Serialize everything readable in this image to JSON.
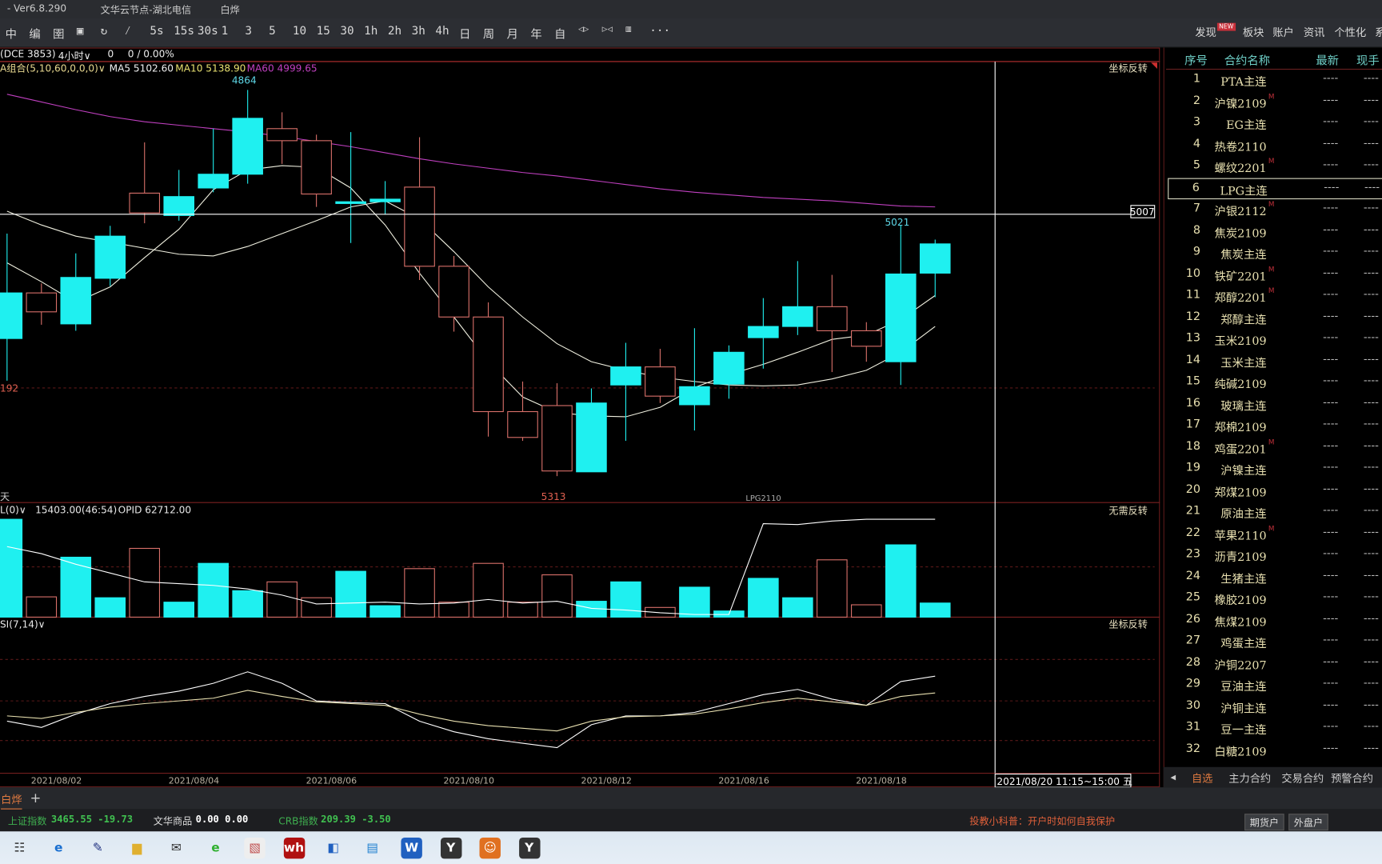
{
  "titlebar": {
    "version": "- Ver6.8.290",
    "server": "文华云节点-湖北电信",
    "account": "白烨"
  },
  "toolbar": {
    "icons": [
      "split-icon",
      "draw-icon",
      "layout-icon",
      "save-icon",
      "refresh-icon",
      "indicator-icon"
    ],
    "periods": [
      "5s",
      "15s",
      "30s",
      "1",
      "3",
      "5",
      "10",
      "15",
      "30",
      "1h",
      "2h",
      "3h",
      "4h",
      "日",
      "周",
      "月",
      "年",
      "自"
    ],
    "tail_icons": [
      "expand-icon",
      "compress-icon",
      "panel-icon"
    ],
    "more": "···",
    "right": [
      "发现",
      "板块",
      "账户",
      "资讯",
      "个性化",
      "系"
    ],
    "new_badge": "NEW"
  },
  "info": {
    "contract": "(DCE 3853)",
    "period": "4小时∨",
    "value": "0",
    "change": "0 / 0.00%"
  },
  "main_panel": {
    "indicator": "A组合(5,10,60,0,0,0)∨",
    "ma5": "MA5 5102.60",
    "ma10": "MA10 5138.90",
    "ma60": "MA60 4999.65",
    "flip": "坐标反转",
    "crosshair_price": "5007",
    "hi_label": "4864",
    "lo_label": "5313",
    "mark_5021": "5021",
    "left_label": "192",
    "contract_tag": "LPG2110",
    "day_label": "天"
  },
  "vol_panel": {
    "header": "L(0)∨",
    "vol": "15403.00(46:54)",
    "opid": "OPID 62712.00",
    "flip": "无需反转"
  },
  "rsi_panel": {
    "header": "SI(7,14)∨",
    "flip": "坐标反转"
  },
  "date_axis": {
    "labels": [
      "2021/08/02",
      "2021/08/04",
      "2021/08/06",
      "2021/08/10",
      "2021/08/12",
      "2021/08/16",
      "2021/08/18"
    ],
    "cursor": "2021/08/20 11:15~15:00 五"
  },
  "colors": {
    "up": "#d9706a",
    "down": "#1ff0f0",
    "ma60": "#c040c0",
    "ma": "#f0f0e0",
    "bg": "#000000"
  },
  "chart_data": [
    {
      "type": "candlestick",
      "axis_inverted": true,
      "ylim": [
        4864,
        5313
      ],
      "candles": [
        {
          "o": 5153,
          "c": 5100,
          "h": 5202,
          "l": 5031
        },
        {
          "o": 5100,
          "c": 5122,
          "h": 5137,
          "l": 5089
        },
        {
          "o": 5136,
          "c": 5082,
          "h": 5144,
          "l": 5054
        },
        {
          "o": 5083,
          "c": 5034,
          "h": 5092,
          "l": 5022
        },
        {
          "o": 4984,
          "c": 5007,
          "h": 5019,
          "l": 4925
        },
        {
          "o": 5010,
          "c": 4988,
          "h": 5016,
          "l": 4957
        },
        {
          "o": 4978,
          "c": 4962,
          "h": 4983,
          "l": 4909
        },
        {
          "o": 4962,
          "c": 4897,
          "h": 4973,
          "l": 4864
        },
        {
          "o": 4909,
          "c": 4923,
          "h": 4950,
          "l": 4890
        },
        {
          "o": 4923,
          "c": 4985,
          "h": 5000,
          "l": 4916
        },
        {
          "o": 4996,
          "c": 4994,
          "h": 5042,
          "l": 4913
        },
        {
          "o": 4994,
          "c": 4991,
          "h": 5009,
          "l": 4970
        },
        {
          "o": 4977,
          "c": 5069,
          "h": 5085,
          "l": 4919
        },
        {
          "o": 5069,
          "c": 5128,
          "h": 5145,
          "l": 5057
        },
        {
          "o": 5128,
          "c": 5238,
          "h": 5267,
          "l": 5111
        },
        {
          "o": 5238,
          "c": 5268,
          "h": 5272,
          "l": 5203
        },
        {
          "o": 5231,
          "c": 5307,
          "h": 5313,
          "l": 5205
        },
        {
          "o": 5308,
          "c": 5228,
          "h": 5308,
          "l": 5211
        },
        {
          "o": 5207,
          "c": 5186,
          "h": 5272,
          "l": 5158
        },
        {
          "o": 5186,
          "c": 5220,
          "h": 5228,
          "l": 5165
        },
        {
          "o": 5230,
          "c": 5209,
          "h": 5260,
          "l": 5141
        },
        {
          "o": 5206,
          "c": 5169,
          "h": 5223,
          "l": 5161
        },
        {
          "o": 5152,
          "c": 5139,
          "h": 5188,
          "l": 5106
        },
        {
          "o": 5139,
          "c": 5116,
          "h": 5149,
          "l": 5063
        },
        {
          "o": 5116,
          "c": 5144,
          "h": 5192,
          "l": 5079
        },
        {
          "o": 5144,
          "c": 5162,
          "h": 5180,
          "l": 5134
        },
        {
          "o": 5180,
          "c": 5078,
          "h": 5207,
          "l": 5021
        },
        {
          "o": 5077,
          "c": 5043,
          "h": 5105,
          "l": 5038
        }
      ],
      "series": [
        {
          "name": "MA5",
          "values": [
            5065,
            5087,
            5111,
            5093,
            5059,
            5026,
            4980,
            4957,
            4952,
            4954,
            4978,
            5021,
            5077,
            5128,
            5180,
            5221,
            5239,
            5243,
            5244,
            5233,
            5210,
            5195,
            5183,
            5169,
            5154,
            5149,
            5131,
            5103
          ]
        },
        {
          "name": "MA10",
          "values": [
            5005,
            5021,
            5034,
            5041,
            5048,
            5055,
            5057,
            5046,
            5031,
            5016,
            5000,
            4993,
            5014,
            5052,
            5093,
            5128,
            5159,
            5180,
            5190,
            5198,
            5203,
            5207,
            5208,
            5207,
            5200,
            5190,
            5169,
            5139
          ]
        },
        {
          "name": "MA60",
          "values": [
            4869,
            4878,
            4887,
            4895,
            4901,
            4905,
            4909,
            4913,
            4918,
            4924,
            4930,
            4937,
            4944,
            4950,
            4955,
            4960,
            4964,
            4969,
            4974,
            4979,
            4983,
            4986,
            4989,
            4991,
            4993,
            4996,
            4999,
            5000
          ]
        }
      ]
    },
    {
      "type": "bar",
      "volume": [
        106900,
        22150,
        65480,
        21190,
        75110,
        16370,
        58740,
        28890,
        38520,
        21190,
        50080,
        12520,
        52970,
        16370,
        58740,
        16370,
        46220,
        17330,
        38520,
        10590,
        32740,
        6740,
        42370,
        21190,
        62600,
        13480,
        78970,
        15403
      ],
      "open_interest": [
        59612,
        58812,
        57612,
        56612,
        55612,
        55412,
        55212,
        54812,
        54112,
        53112,
        53212,
        53312,
        53112,
        53212,
        53612,
        53212,
        53412,
        52612,
        52412,
        52112,
        51912,
        51912,
        62212,
        62112,
        62512,
        62712,
        62712,
        62712
      ]
    },
    {
      "type": "line",
      "axis_inverted": true,
      "gridlines": [
        20,
        50,
        80
      ],
      "series": [
        {
          "values": [
            65.0,
            69.6,
            59.8,
            52.0,
            46.7,
            42.8,
            37.0,
            28.5,
            37.0,
            50,
            51.3,
            52.0,
            65.0,
            72.8,
            78.0,
            81.3,
            84.6,
            67.6,
            61.1,
            61.1,
            58.5,
            52.0,
            45.4,
            41.5,
            48.7,
            53.3,
            35.7,
            31.7
          ]
        },
        {
          "values": [
            61.1,
            63.0,
            58.5,
            54.6,
            52.0,
            50,
            48.0,
            42.2,
            46.7,
            50.7,
            52.0,
            53.3,
            59.8,
            65.0,
            68.3,
            70.2,
            72.2,
            65.0,
            61.7,
            61.1,
            59.8,
            55.9,
            51.3,
            48.0,
            50.7,
            53.3,
            46.7,
            44.1
          ]
        }
      ]
    }
  ],
  "quote_list": {
    "headers": [
      "序号",
      "合约名称",
      "最新",
      "现手"
    ],
    "dash": "----",
    "rows": [
      {
        "n": "1",
        "name": "PTA主连"
      },
      {
        "n": "2",
        "name": "沪镍2109",
        "m": "M"
      },
      {
        "n": "3",
        "name": "EG主连"
      },
      {
        "n": "4",
        "name": "热卷2110"
      },
      {
        "n": "5",
        "name": "螺纹2201",
        "m": "M"
      },
      {
        "n": "6",
        "name": "LPG主连"
      },
      {
        "n": "7",
        "name": "沪银2112",
        "m": "M"
      },
      {
        "n": "8",
        "name": "焦炭2109"
      },
      {
        "n": "9",
        "name": "焦炭主连"
      },
      {
        "n": "10",
        "name": "铁矿2201",
        "m": "M"
      },
      {
        "n": "11",
        "name": "郑醇2201",
        "m": "M"
      },
      {
        "n": "12",
        "name": "郑醇主连"
      },
      {
        "n": "13",
        "name": "玉米2109"
      },
      {
        "n": "14",
        "name": "玉米主连"
      },
      {
        "n": "15",
        "name": "纯碱2109"
      },
      {
        "n": "16",
        "name": "玻璃主连"
      },
      {
        "n": "17",
        "name": "郑棉2109"
      },
      {
        "n": "18",
        "name": "鸡蛋2201",
        "m": "M"
      },
      {
        "n": "19",
        "name": "沪镍主连"
      },
      {
        "n": "20",
        "name": "郑煤2109"
      },
      {
        "n": "21",
        "name": "原油主连"
      },
      {
        "n": "22",
        "name": "苹果2110",
        "m": "M"
      },
      {
        "n": "23",
        "name": "沥青2109"
      },
      {
        "n": "24",
        "name": "生猪主连"
      },
      {
        "n": "25",
        "name": "橡胶2109"
      },
      {
        "n": "26",
        "name": "焦煤2109"
      },
      {
        "n": "27",
        "name": "鸡蛋主连"
      },
      {
        "n": "28",
        "name": "沪铜2207"
      },
      {
        "n": "29",
        "name": "豆油主连"
      },
      {
        "n": "30",
        "name": "沪铜主连"
      },
      {
        "n": "31",
        "name": "豆一主连"
      },
      {
        "n": "32",
        "name": "白糖2109"
      }
    ],
    "tabs": [
      "自选",
      "主力合约",
      "交易合约",
      "预警合约"
    ],
    "prev": "◂"
  },
  "tabbar": {
    "tab": "白烨",
    "add": "+"
  },
  "status": {
    "sh_label": "上证指数",
    "sh_value": "3465.55 -19.73",
    "wh_label": "文华商品",
    "wh_value": "0.00 0.00",
    "crb_label": "CRB指数",
    "crb_value": "209.39 -3.50",
    "notice": "投教小科普：开户时如何自我保护",
    "btn1": "期货户",
    "btn2": "外盘户"
  },
  "taskbar": {
    "icons": [
      "task-view-icon",
      "edge-icon",
      "brush-icon",
      "file-explorer-icon",
      "mail-icon",
      "browser-icon",
      "paint-icon",
      "wenhua-icon",
      "app-icon",
      "tv-icon",
      "wps-icon",
      "yi-icon",
      "game-icon",
      "yi-icon-2"
    ]
  }
}
